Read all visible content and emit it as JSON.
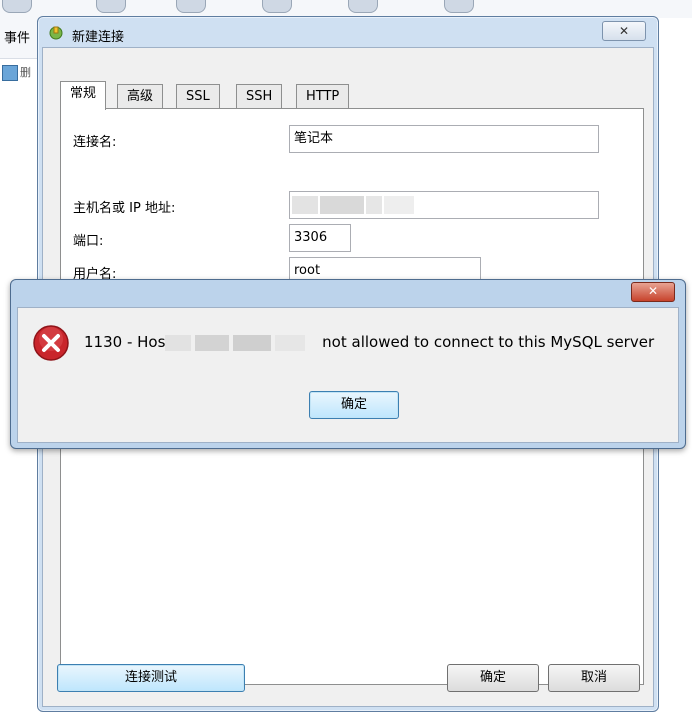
{
  "background": {
    "menu_label": "事件",
    "row2_label": "删"
  },
  "dialog": {
    "title": "新建连接",
    "close_label": "✕",
    "tabs": [
      "常规",
      "高级",
      "SSL",
      "SSH",
      "HTTP"
    ],
    "fields": {
      "connection_name_label": "连接名:",
      "connection_name_value": "笔记本",
      "host_label": "主机名或 IP 地址:",
      "port_label": "端口:",
      "port_value": "3306",
      "user_label": "用户名:",
      "user_value": "root"
    },
    "buttons": {
      "test": "连接测试",
      "ok": "确定",
      "cancel": "取消"
    }
  },
  "error": {
    "close_label": "✕",
    "message_prefix": "1130 - Hos",
    "message_suffix": " not allowed to connect to this MySQL server",
    "ok_label": "确定"
  },
  "colors": {
    "error_red": "#c9252b",
    "window_frame": "#cfe0f2"
  }
}
